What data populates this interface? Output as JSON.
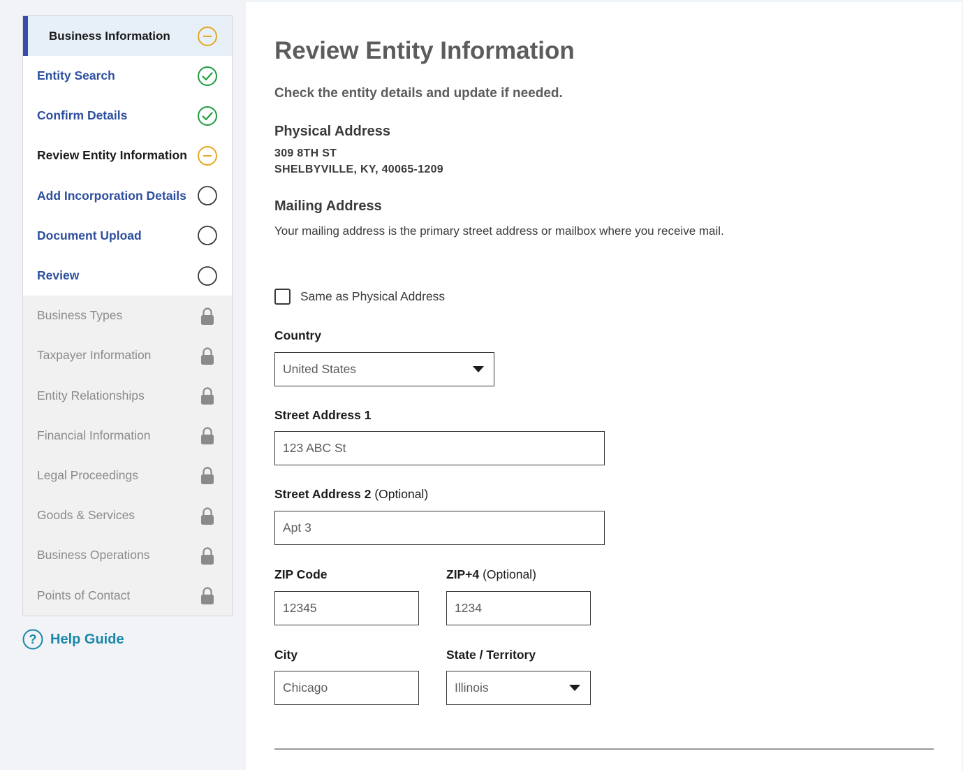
{
  "sidenav": {
    "section_title": "Business Information",
    "items": [
      {
        "label": "Entity Search",
        "status": "complete"
      },
      {
        "label": "Confirm Details",
        "status": "complete"
      },
      {
        "label": "Review Entity Information",
        "status": "in-progress"
      },
      {
        "label": "Add Incorporation Details",
        "status": "not-started"
      },
      {
        "label": "Document Upload",
        "status": "not-started"
      },
      {
        "label": "Review",
        "status": "not-started"
      },
      {
        "label": "Business Types",
        "status": "locked"
      },
      {
        "label": "Taxpayer Information",
        "status": "locked"
      },
      {
        "label": "Entity Relationships",
        "status": "locked"
      },
      {
        "label": "Financial Information",
        "status": "locked"
      },
      {
        "label": "Legal Proceedings",
        "status": "locked"
      },
      {
        "label": "Goods & Services",
        "status": "locked"
      },
      {
        "label": "Business Operations",
        "status": "locked"
      },
      {
        "label": "Points of Contact",
        "status": "locked"
      }
    ]
  },
  "help": {
    "label": "Help Guide",
    "icon": "question-circle-icon"
  },
  "main": {
    "title": "Review Entity Information",
    "subtitle": "Check the entity details and update if needed.",
    "physical": {
      "heading": "Physical Address",
      "line1": "309 8TH ST",
      "line2": "SHELBYVILLE, KY, 40065-1209"
    },
    "mailing": {
      "heading": "Mailing Address",
      "hint": "Your mailing address is the primary street address or mailbox where you receive mail.",
      "same_as_physical_label": "Same as Physical Address",
      "same_as_physical_checked": false
    },
    "fields": {
      "country": {
        "label": "Country",
        "value": "United States"
      },
      "street1": {
        "label": "Street Address 1",
        "placeholder": "123 ABC St"
      },
      "street2": {
        "label": "Street Address 2",
        "optional": "(Optional)",
        "placeholder": "Apt 3"
      },
      "zip": {
        "label": "ZIP Code",
        "placeholder": "12345"
      },
      "zip4": {
        "label": "ZIP+4",
        "optional": "(Optional)",
        "placeholder": "1234"
      },
      "city": {
        "label": "City",
        "placeholder": "Chicago"
      },
      "state": {
        "label": "State / Territory",
        "value": "Illinois"
      }
    }
  },
  "colors": {
    "accent_bar": "#3a4ca8",
    "link": "#2e4f9e",
    "complete_green": "#1e9e3e",
    "in_progress_gold": "#e5a823",
    "help_teal": "#1a87a9"
  }
}
